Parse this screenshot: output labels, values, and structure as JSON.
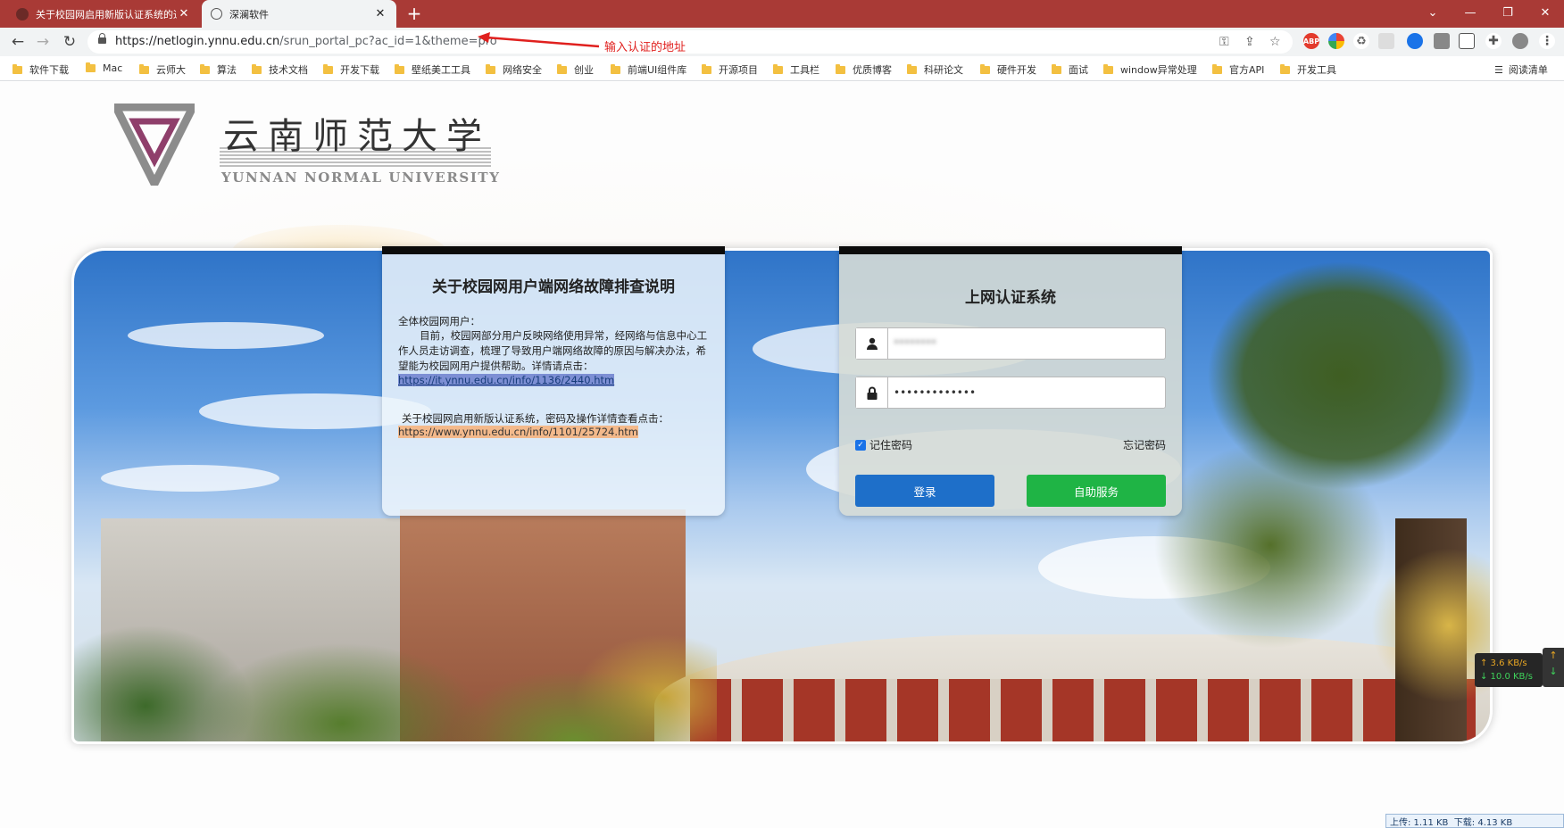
{
  "browser": {
    "tabs": [
      {
        "title": "关于校园网启用新版认证系统的通知",
        "active": false
      },
      {
        "title": "深澜软件",
        "active": true
      }
    ],
    "new_tab": "+",
    "window_controls": {
      "list": "⌄",
      "minimize": "—",
      "restore": "❐",
      "close": "✕"
    },
    "url_host": "https://netlogin.ynnu.edu.cn",
    "url_path": "/srun_portal_pc?ac_id=1&theme=pro",
    "annotation": "输入认证的地址",
    "extension_abp": "ABP",
    "bookmarks": [
      "软件下载",
      "Mac",
      "云师大",
      "算法",
      "技术文档",
      "开发下载",
      "壁纸美工工具",
      "网络安全",
      "创业",
      "前端UI组件库",
      "开源项目",
      "工具栏",
      "优质博客",
      "科研论文",
      "硬件开发",
      "面试",
      "window异常处理",
      "官方API",
      "开发工具"
    ],
    "reading_list": "阅读清单",
    "accent_color": "#a93a36"
  },
  "page": {
    "logo_en": "YUNNAN NORMAL UNIVERSITY",
    "logo_cn": "云南师范大学",
    "notice": {
      "title": "关于校园网用户端网络故障排查说明",
      "greeting": "全体校园网用户：",
      "body": "目前，校园网部分用户反映网络使用异常，经网络与信息中心工作人员走访调查，梳理了导致用户端网络故障的原因与解决办法，希望能为校园网用户提供帮助。详情请点击：",
      "link1": "https://it.ynnu.edu.cn/info/1136/2440.htm",
      "text2": "关于校园网启用新版认证系统，密码及操作详情查看点击：",
      "link2": "https://www.ynnu.edu.cn/info/1101/25724.htm"
    },
    "login": {
      "title": "上网认证系统",
      "username_value": "********",
      "password_value": "•••••••••••••",
      "remember_label": "记住密码",
      "remember_checked": true,
      "forgot_label": "忘记密码",
      "login_button": "登录",
      "self_service_button": "自助服务",
      "login_color": "#1e6fc9",
      "self_service_color": "#1fb445"
    }
  },
  "net_speed": {
    "up": "↑ 3.6 KB/s",
    "down": "↓ 10.0 KB/s",
    "upload_total": "上传: 1.11 KB",
    "download_total": "下载: 4.13 KB"
  }
}
